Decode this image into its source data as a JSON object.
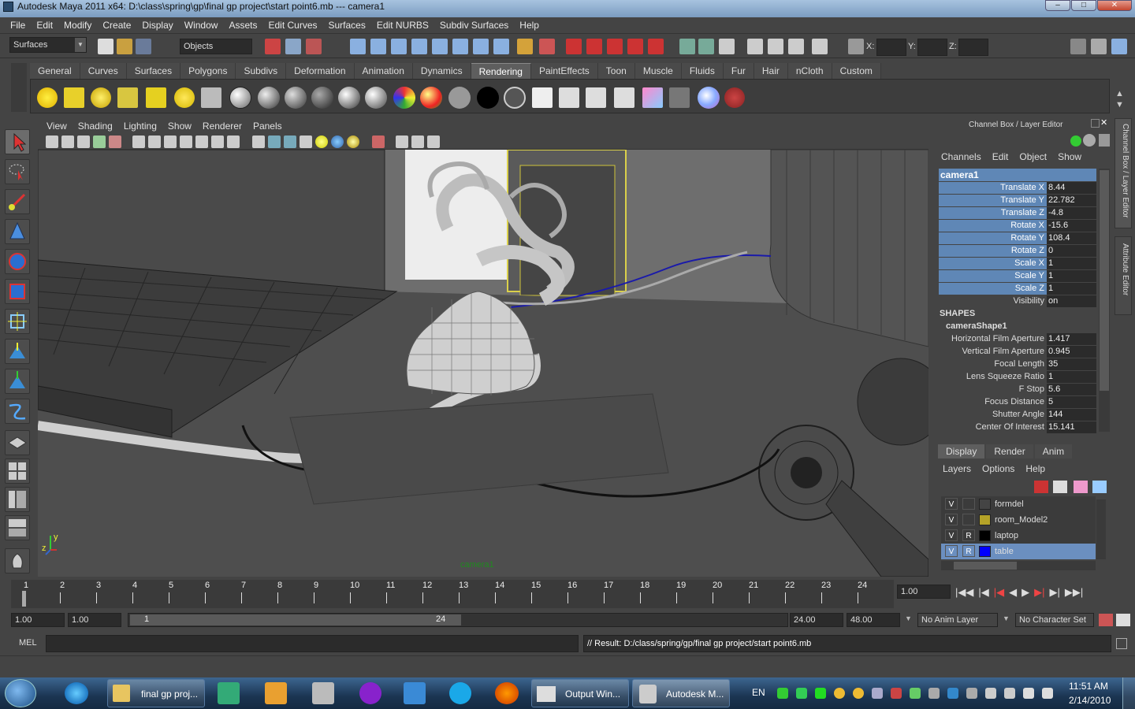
{
  "window": {
    "title": "Autodesk Maya 2011 x64: D:\\class\\spring\\gp\\final gp project\\start point6.mb   ---   camera1"
  },
  "menu": [
    "File",
    "Edit",
    "Modify",
    "Create",
    "Display",
    "Window",
    "Assets",
    "Edit Curves",
    "Surfaces",
    "Edit NURBS",
    "Subdiv Surfaces",
    "Help"
  ],
  "status": {
    "menuset": "Surfaces",
    "selection_mask": "Objects",
    "x_label": "X:",
    "y_label": "Y:",
    "z_label": "Z:"
  },
  "shelf_tabs": [
    "General",
    "Curves",
    "Surfaces",
    "Polygons",
    "Subdivs",
    "Deformation",
    "Animation",
    "Dynamics",
    "Rendering",
    "PaintEffects",
    "Toon",
    "Muscle",
    "Fluids",
    "Fur",
    "Hair",
    "nCloth",
    "Custom"
  ],
  "shelf_active": "Rendering",
  "viewport": {
    "menus": [
      "View",
      "Shading",
      "Lighting",
      "Show",
      "Renderer",
      "Panels"
    ],
    "camera_label": "camera1",
    "axis_y": "y",
    "axis_z": "z"
  },
  "channelbox": {
    "title": "Channel Box / Layer Editor",
    "menus": [
      "Channels",
      "Edit",
      "Object",
      "Show"
    ],
    "object": "camera1",
    "attrs": [
      {
        "label": "Translate X",
        "value": "8.44"
      },
      {
        "label": "Translate Y",
        "value": "22.782"
      },
      {
        "label": "Translate Z",
        "value": "-4.8"
      },
      {
        "label": "Rotate X",
        "value": "-15.6"
      },
      {
        "label": "Rotate Y",
        "value": "108.4"
      },
      {
        "label": "Rotate Z",
        "value": "0"
      },
      {
        "label": "Scale X",
        "value": "1"
      },
      {
        "label": "Scale Y",
        "value": "1"
      },
      {
        "label": "Scale Z",
        "value": "1"
      },
      {
        "label": "Visibility",
        "value": "on"
      }
    ],
    "shapes_header": "SHAPES",
    "shape_name": "cameraShape1",
    "shape_attrs": [
      {
        "label": "Horizontal Film Aperture",
        "value": "1.417"
      },
      {
        "label": "Vertical Film Aperture",
        "value": "0.945"
      },
      {
        "label": "Focal Length",
        "value": "35"
      },
      {
        "label": "Lens Squeeze Ratio",
        "value": "1"
      },
      {
        "label": "F Stop",
        "value": "5.6"
      },
      {
        "label": "Focus Distance",
        "value": "5"
      },
      {
        "label": "Shutter Angle",
        "value": "144"
      },
      {
        "label": "Center Of Interest",
        "value": "15.141"
      }
    ],
    "side_tabs": [
      "Channel Box / Layer Editor",
      "Attribute Editor"
    ]
  },
  "layers": {
    "tabs": [
      "Display",
      "Render",
      "Anim"
    ],
    "menus": [
      "Layers",
      "Options",
      "Help"
    ],
    "rows": [
      {
        "v": "V",
        "r": "",
        "name": "formdel",
        "color": "#444444"
      },
      {
        "v": "V",
        "r": "",
        "name": "room_Model2",
        "color": "#b5a328"
      },
      {
        "v": "V",
        "r": "R",
        "name": "laptop",
        "color": "#000000"
      },
      {
        "v": "V",
        "r": "R",
        "name": "table",
        "color": "#0000ff"
      }
    ]
  },
  "timeline": {
    "ticks": [
      "1",
      "2",
      "3",
      "4",
      "5",
      "6",
      "7",
      "8",
      "9",
      "10",
      "11",
      "12",
      "13",
      "14",
      "15",
      "16",
      "17",
      "18",
      "19",
      "20",
      "21",
      "22",
      "23",
      "24"
    ],
    "current_time": "1.00"
  },
  "range": {
    "start": "1.00",
    "start2": "1.00",
    "range_start": "1",
    "range_end": "24",
    "end": "24.00",
    "end2": "48.00",
    "anim_layer": "No Anim Layer",
    "character_set": "No Character Set"
  },
  "mel": {
    "label": "MEL",
    "result": "// Result: D:/class/spring/gp/final gp project/start point6.mb"
  },
  "taskbar": {
    "items": [
      "final gp proj...",
      "Output Win...",
      "Autodesk M..."
    ],
    "lang": "EN",
    "time": "11:51 AM",
    "date": "2/14/2010"
  }
}
